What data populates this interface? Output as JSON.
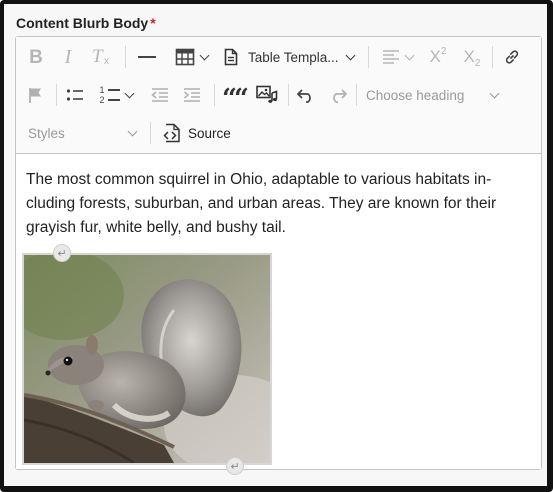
{
  "field": {
    "label": "Content Blurb Body",
    "required_marker": "*"
  },
  "toolbar": {
    "bold": "B",
    "italic": "I",
    "clear_format": "T",
    "clear_format_sub": "x",
    "table_template_label": "Table Templa...",
    "superscript": "X",
    "superscript_mark": "2",
    "subscript": "X",
    "subscript_mark": "2",
    "numbered_list_top": "1",
    "numbered_list_bottom": "2",
    "blockquote": "““",
    "heading_placeholder": "Choose heading",
    "styles_placeholder": "Styles",
    "source_label": "Source",
    "icons": [
      "bold-icon",
      "italic-icon",
      "remove-format-icon",
      "horizontal-line-icon",
      "table-icon",
      "document-icon",
      "align-icon",
      "superscript-icon",
      "subscript-icon",
      "link-icon",
      "flag-icon",
      "bulleted-list-icon",
      "numbered-list-icon",
      "outdent-icon",
      "indent-icon",
      "blockquote-icon",
      "insert-media-icon",
      "undo-icon",
      "redo-icon",
      "source-icon"
    ]
  },
  "content": {
    "paragraph": "The most common squirrel in Ohio, adaptable to various habitats in-cluding forests, suburban, and urban areas. They are known for their grayish fur, white belly, and bushy tail.",
    "image_handle_glyph": "↵"
  },
  "colors": {
    "required": "#d21f2b",
    "frame": "#111111",
    "border": "#c4c4c4"
  }
}
